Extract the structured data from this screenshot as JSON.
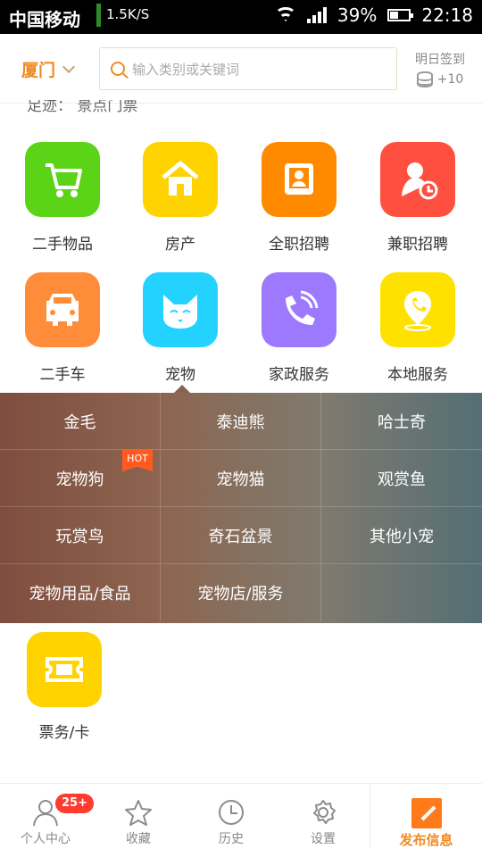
{
  "status_bar": {
    "carrier": "中国移动",
    "network_speed": "1.5K/S",
    "battery": "39%",
    "time": "22:18"
  },
  "header": {
    "city": "厦门",
    "search_placeholder": "输入类别或关键词",
    "sign_in": {
      "label": "明日签到",
      "reward": "+10"
    }
  },
  "partial_text": "足迹： 景点门票",
  "categories": [
    {
      "label": "二手物品",
      "color": "#5bd316",
      "icon": "cart-icon"
    },
    {
      "label": "房产",
      "color": "#ffd300",
      "icon": "house-icon"
    },
    {
      "label": "全职招聘",
      "color": "#ff8a00",
      "icon": "id-card-icon"
    },
    {
      "label": "兼职招聘",
      "color": "#ff4f3f",
      "icon": "person-clock-icon"
    },
    {
      "label": "二手车",
      "color": "#ff8c38",
      "icon": "car-icon"
    },
    {
      "label": "宠物",
      "color": "#24d2ff",
      "icon": "cat-icon"
    },
    {
      "label": "家政服务",
      "color": "#9c79ff",
      "icon": "phone-icon"
    },
    {
      "label": "本地服务",
      "color": "#ffe100",
      "icon": "location-phone-icon"
    }
  ],
  "pet_menu": {
    "hot_badge": "HOT",
    "items": [
      {
        "label": "金毛"
      },
      {
        "label": "泰迪熊"
      },
      {
        "label": "哈士奇"
      },
      {
        "label": "宠物狗",
        "hot": true
      },
      {
        "label": "宠物猫"
      },
      {
        "label": "观赏鱼"
      },
      {
        "label": "玩赏鸟"
      },
      {
        "label": "奇石盆景"
      },
      {
        "label": "其他小宠"
      },
      {
        "label": "宠物用品/食品"
      },
      {
        "label": "宠物店/服务"
      }
    ]
  },
  "ticket": {
    "label": "票务/卡",
    "color": "#ffd300",
    "icon": "ticket-icon"
  },
  "tabbar": {
    "badge": "25+",
    "items": [
      {
        "label": "个人中心",
        "icon": "user-icon"
      },
      {
        "label": "收藏",
        "icon": "star-icon"
      },
      {
        "label": "历史",
        "icon": "clock-icon"
      },
      {
        "label": "设置",
        "icon": "gear-icon"
      }
    ],
    "publish": {
      "label": "发布信息",
      "icon": "edit-icon"
    }
  }
}
